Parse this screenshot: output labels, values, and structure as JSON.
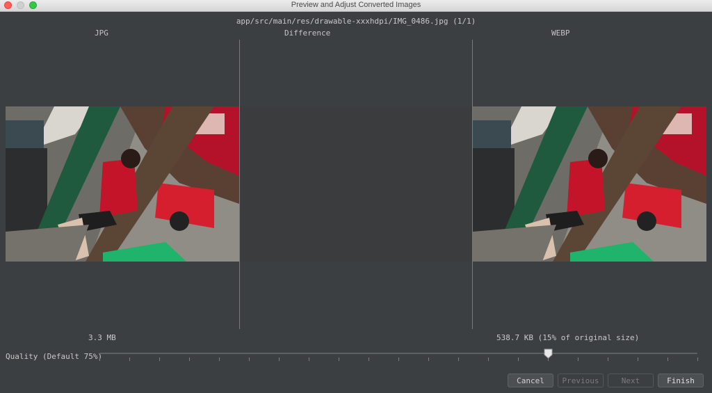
{
  "window": {
    "title": "Preview and Adjust Converted Images"
  },
  "header": {
    "file_path": "app/src/main/res/drawable-xxxhdpi/IMG_0486.jpg (1/1)"
  },
  "columns": {
    "left": "JPG",
    "middle": "Difference",
    "right": "WEBP"
  },
  "sizes": {
    "original": "3.3 MB",
    "converted": "538.7 KB (15% of original size)"
  },
  "quality": {
    "label": "Quality (Default 75%)",
    "value_percent": 75
  },
  "buttons": {
    "cancel": "Cancel",
    "previous": "Previous",
    "next": "Next",
    "finish": "Finish"
  },
  "colors": {
    "background": "#3c3f41",
    "text": "#bbbbbb",
    "close": "#fc5f57",
    "maximize": "#34c84a"
  }
}
